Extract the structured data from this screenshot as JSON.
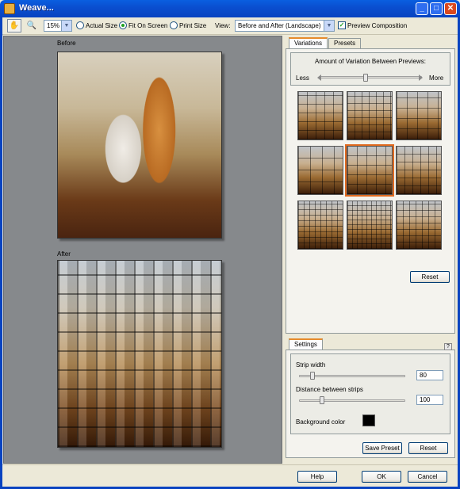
{
  "window": {
    "title": "Weave..."
  },
  "toolbar": {
    "zoom_value": "15%",
    "actual_size": "Actual Size",
    "fit_on_screen": "Fit On Screen",
    "print_size": "Print Size",
    "view_label": "View:",
    "view_value": "Before and After (Landscape)",
    "preview_composition": "Preview Composition",
    "selected_mode": "Fit On Screen",
    "preview_checked": true
  },
  "preview": {
    "before_label": "Before",
    "after_label": "After"
  },
  "variations": {
    "tabs": [
      "Variations",
      "Presets"
    ],
    "active_tab": "Variations",
    "amount_label": "Amount of Variation Between Previews:",
    "less": "Less",
    "more": "More",
    "amount_level": 0.45,
    "selected_index": 4,
    "reset": "Reset"
  },
  "settings": {
    "tab": "Settings",
    "help": "?",
    "strip_width_label": "Strip width",
    "strip_width": "80",
    "distance_label": "Distance between strips",
    "distance": "100",
    "background_label": "Background color",
    "background_color": "#000000",
    "save_preset": "Save Preset",
    "reset": "Reset"
  },
  "footer": {
    "help": "Help",
    "ok": "OK",
    "cancel": "Cancel"
  }
}
